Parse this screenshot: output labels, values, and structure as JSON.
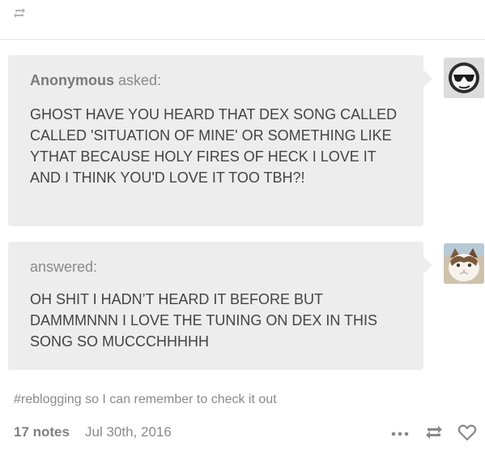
{
  "post": {
    "ask": {
      "asker_name": "Anonymous",
      "asked_label": "asked:",
      "question": "GHOST HAVE YOU HEARD THAT DEX SONG CALLED CALLED 'SITUATION OF MINE' OR SOMETHING LIKE YTHAT BECAUSE HOLY FIRES OF HECK I LOVE IT AND I THINK YOU'D LOVE IT TOO TBH?!"
    },
    "answer": {
      "answered_label": "answered:",
      "text": "OH SHIT I HADN’T HEARD IT BEFORE BUT DAMMMNNN I LOVE THE TUNING ON DEX IN THIS SONG SO MUCCCHHHHH"
    },
    "tags": "#reblogging so I can remember to check it out",
    "footer": {
      "notes": "17 notes",
      "date": "Jul 30th, 2016"
    }
  },
  "icons": {
    "top": "reblog-icon",
    "anon_avatar": "sunglasses-face-icon",
    "answerer_avatar": "cat-avatar",
    "more": "ellipsis-icon",
    "reblog": "reblog-icon",
    "like": "heart-icon"
  },
  "colors": {
    "bubble": "#ededed",
    "text": "#444444",
    "muted": "#8a8a8a"
  }
}
